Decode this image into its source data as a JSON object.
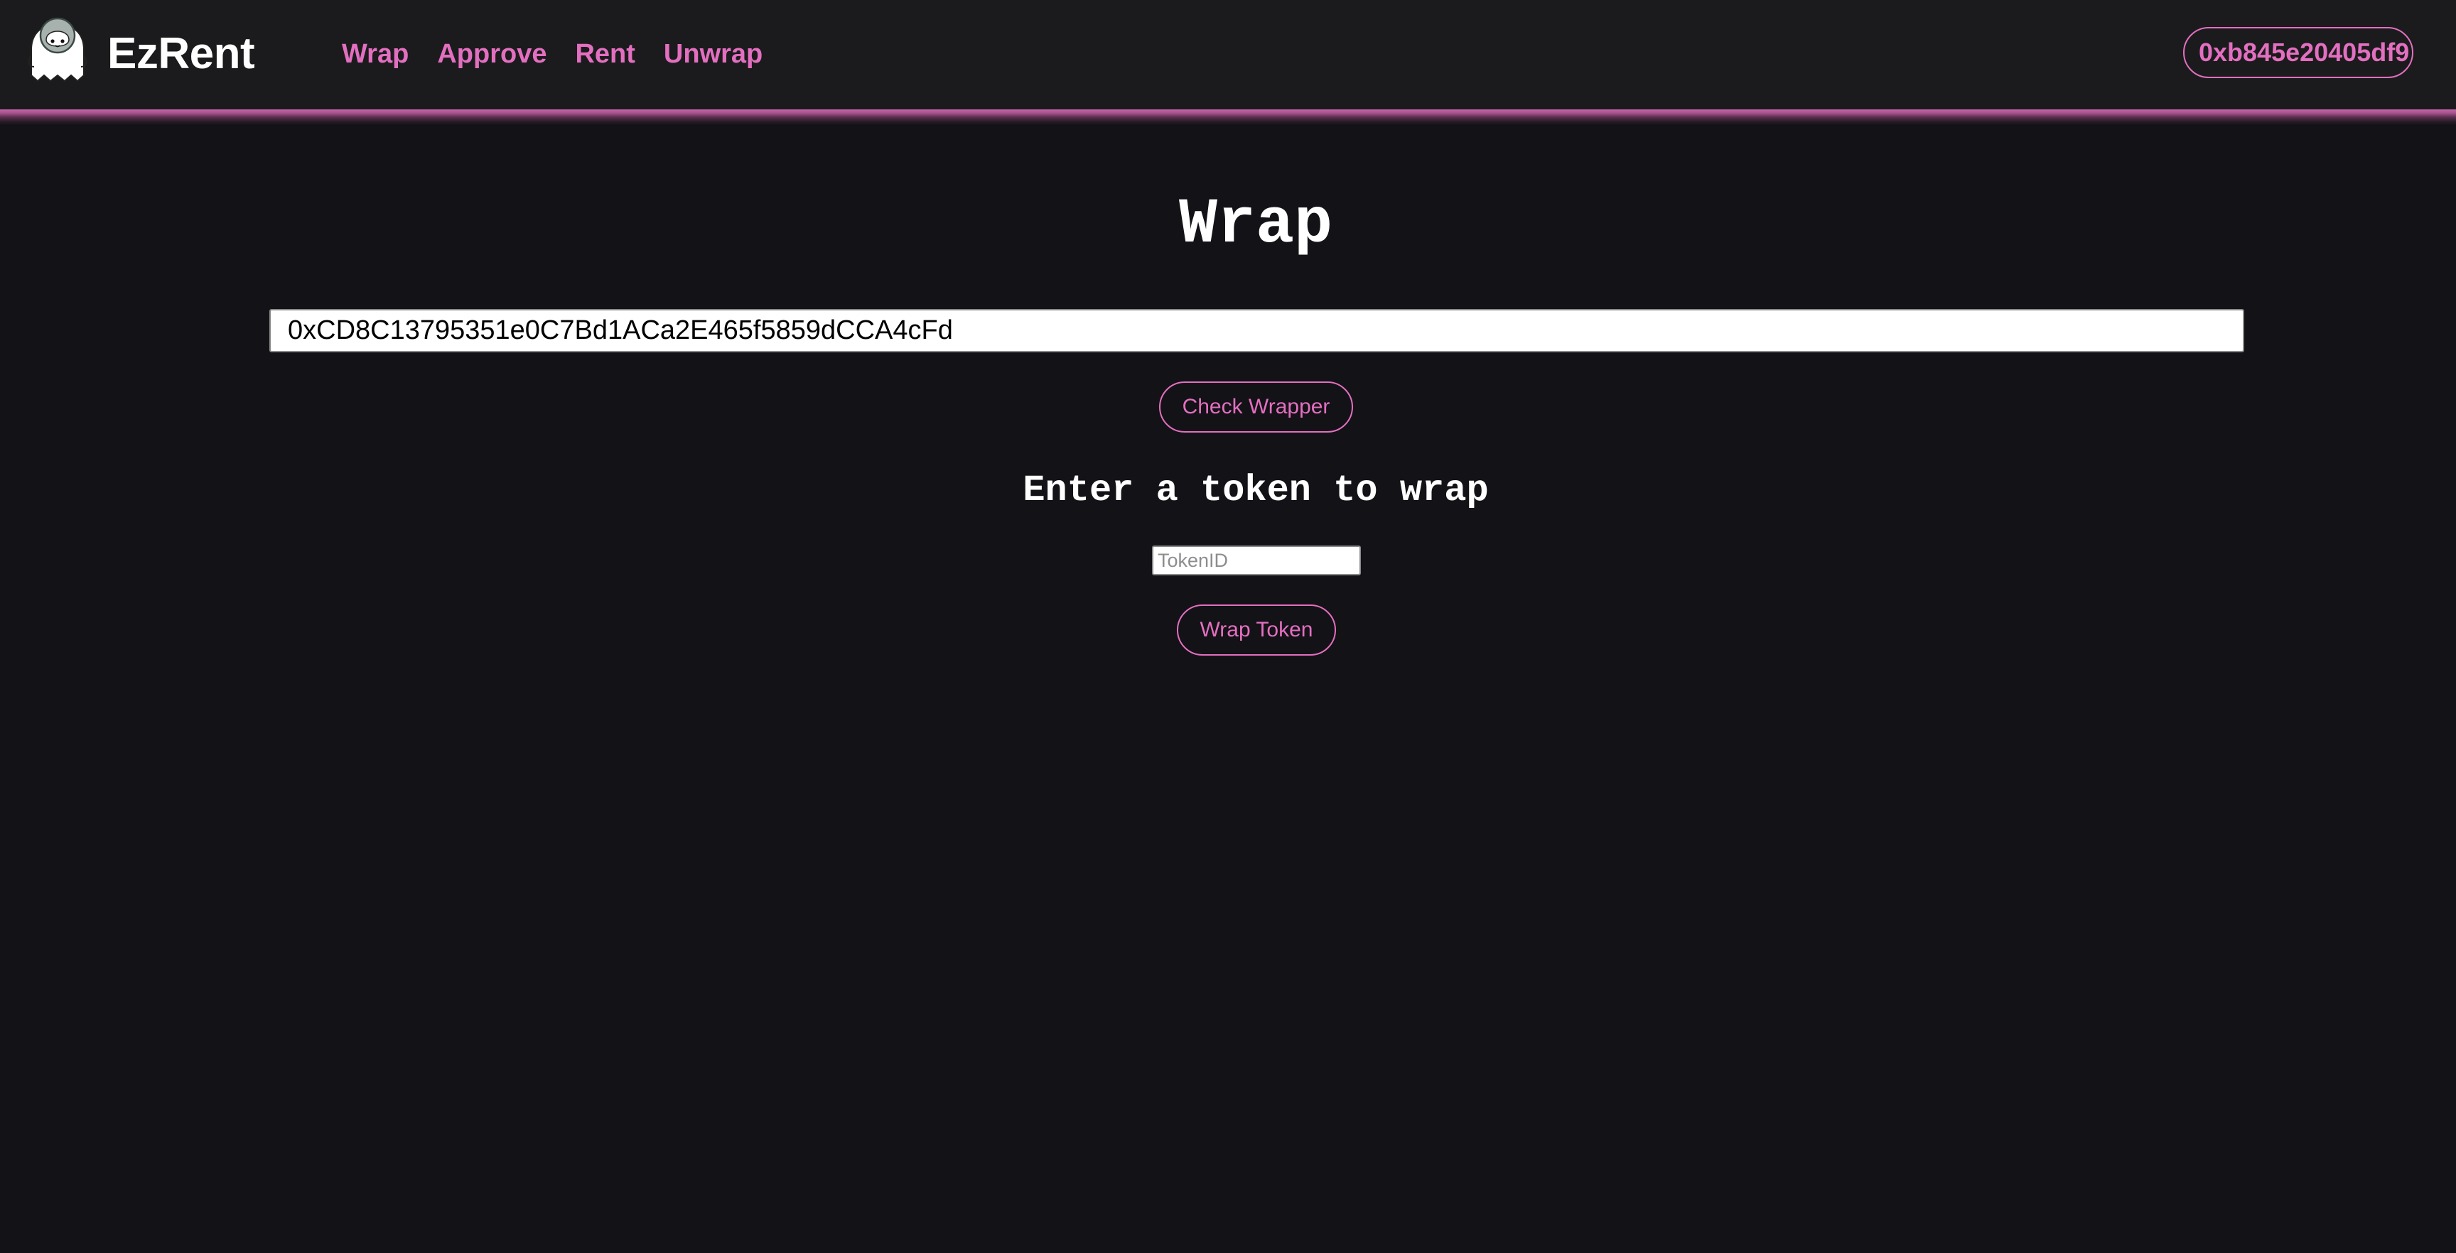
{
  "header": {
    "brand": "EzRent",
    "logo_icon": "ghost-logo-icon",
    "nav": [
      {
        "label": "Wrap"
      },
      {
        "label": "Approve"
      },
      {
        "label": "Rent"
      },
      {
        "label": "Unwrap"
      }
    ],
    "wallet_address": "0xb845e20405df9"
  },
  "main": {
    "title": "Wrap",
    "wrapper_address_value": "0xCD8C13795351e0C7Bd1ACa2E465f5859dCCA4cFd",
    "check_wrapper_label": "Check Wrapper",
    "subheading": "Enter a token to wrap",
    "token_placeholder": "TokenID",
    "token_value": "",
    "wrap_token_label": "Wrap Token"
  },
  "colors": {
    "accent": "#e36fc0",
    "background": "#131217",
    "navbar": "#1b1b1d"
  }
}
